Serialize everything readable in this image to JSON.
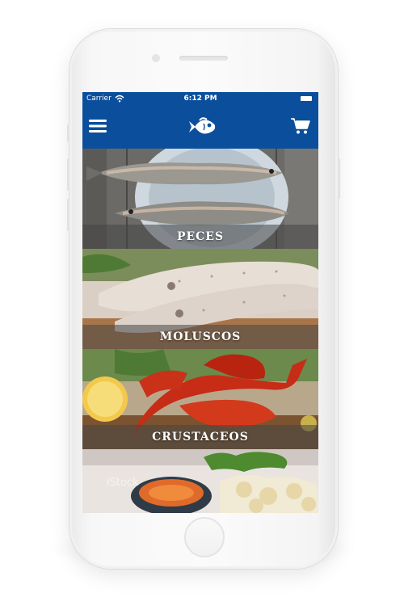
{
  "status_bar": {
    "carrier": "Carrier",
    "time": "6:12 PM"
  },
  "nav": {
    "menu_icon": "hamburger-menu-icon",
    "logo_icon": "fish-logo-icon",
    "cart_icon": "shopping-cart-icon"
  },
  "categories": [
    {
      "label": "PECES"
    },
    {
      "label": "MOLUSCOS"
    },
    {
      "label": "CRUSTACEOS"
    },
    {
      "label": "",
      "watermark": "iStock"
    }
  ],
  "colors": {
    "nav_blue": "#0b4f9c"
  }
}
